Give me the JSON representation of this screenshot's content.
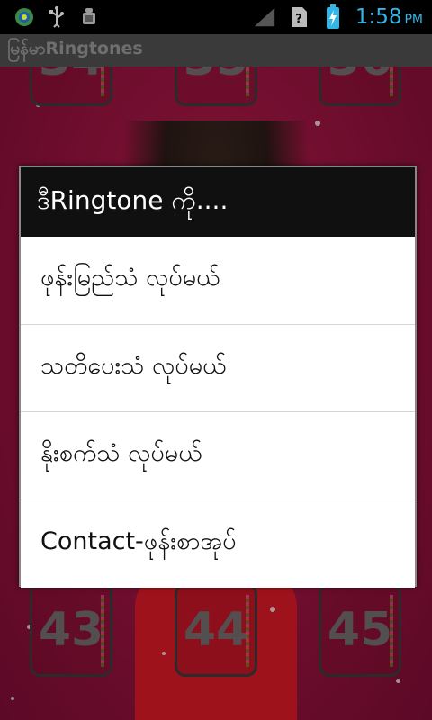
{
  "status_bar": {
    "time": "1:58",
    "ampm": "PM",
    "icons": [
      "app-notification-icon",
      "usb-icon",
      "android-debug-icon",
      "signal-icon",
      "no-sim-icon",
      "battery-charging-icon"
    ],
    "clock_color": "#33b5e5"
  },
  "title_bar": {
    "title": "မြန်မာRingtones"
  },
  "background": {
    "tiles_top": [
      "34",
      "35",
      "36"
    ],
    "tiles_bottom": [
      "43",
      "44",
      "45"
    ],
    "accent": "#a01844"
  },
  "dialog": {
    "title": "ဒီRingtone ကို....",
    "options": [
      {
        "label": "ဖုန်းမြည်သံ လုပ်မယ်"
      },
      {
        "label": "သတိပေးသံ လုပ်မယ်"
      },
      {
        "label": "နိုးစက်သံ လုပ်မယ်"
      },
      {
        "label": "Contact-ဖုန်းစာအုပ်"
      }
    ]
  }
}
